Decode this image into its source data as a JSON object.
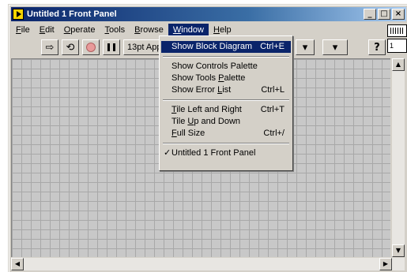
{
  "window": {
    "title": "Untitled 1 Front Panel"
  },
  "titlebar_buttons": {
    "minimize": "_",
    "restore": "□",
    "close": "×"
  },
  "menubar": [
    {
      "pre": "",
      "u": "F",
      "post": "ile",
      "active": false
    },
    {
      "pre": "",
      "u": "E",
      "post": "dit",
      "active": false
    },
    {
      "pre": "",
      "u": "O",
      "post": "perate",
      "active": false
    },
    {
      "pre": "",
      "u": "T",
      "post": "ools",
      "active": false
    },
    {
      "pre": "",
      "u": "B",
      "post": "rowse",
      "active": false
    },
    {
      "pre": "",
      "u": "W",
      "post": "indow",
      "active": true
    },
    {
      "pre": "",
      "u": "H",
      "post": "elp",
      "active": false
    }
  ],
  "toolbar": {
    "run_icon": "⇨",
    "run_continuous_icon": "⟲",
    "font_label": "13pt Applica",
    "align_icon": "▾",
    "reorder_icon": "▾",
    "help_icon": "?"
  },
  "connector": {
    "label": "1"
  },
  "window_menu": {
    "groups": [
      [
        {
          "pre": "Show Block Diagram",
          "u": "",
          "post": "",
          "shortcut": "Ctrl+E",
          "highlight": true,
          "checked": false
        }
      ],
      [
        {
          "pre": "Show Controls Palette",
          "u": "",
          "post": "",
          "shortcut": "",
          "highlight": false,
          "checked": false
        },
        {
          "pre": "Show Tools ",
          "u": "P",
          "post": "alette",
          "shortcut": "",
          "highlight": false,
          "checked": false
        },
        {
          "pre": "Show Error ",
          "u": "L",
          "post": "ist",
          "shortcut": "Ctrl+L",
          "highlight": false,
          "checked": false
        }
      ],
      [
        {
          "pre": "",
          "u": "T",
          "post": "ile Left and Right",
          "shortcut": "Ctrl+T",
          "highlight": false,
          "checked": false
        },
        {
          "pre": "Tile ",
          "u": "U",
          "post": "p and Down",
          "shortcut": "",
          "highlight": false,
          "checked": false
        },
        {
          "pre": "",
          "u": "F",
          "post": "ull Size",
          "shortcut": "Ctrl+/",
          "highlight": false,
          "checked": false
        }
      ],
      [
        {
          "pre": "Untitled 1 Front Panel",
          "u": "",
          "post": "",
          "shortcut": "",
          "highlight": false,
          "checked": true,
          "check": "✓"
        }
      ]
    ]
  },
  "scrollbars": {
    "up": "▲",
    "down": "▼",
    "left": "◀",
    "right": "▶"
  }
}
